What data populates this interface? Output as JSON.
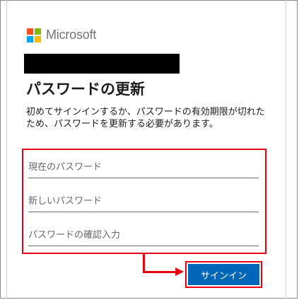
{
  "brand": {
    "name": "Microsoft",
    "logo_colors": [
      "#f25022",
      "#7fba00",
      "#00a4ef",
      "#ffb900"
    ]
  },
  "page": {
    "title": "パスワードの更新",
    "description": "初めてサインインするか、パスワードの有効期限が切れたため、パスワードを更新する必要があります。"
  },
  "form": {
    "current_password": {
      "placeholder": "現在のパスワード",
      "value": ""
    },
    "new_password": {
      "placeholder": "新しいパスワード",
      "value": ""
    },
    "confirm_password": {
      "placeholder": "パスワードの確認入力",
      "value": ""
    },
    "submit_label": "サインイン"
  },
  "colors": {
    "accent": "#0067b8",
    "highlight": "#e60012"
  }
}
